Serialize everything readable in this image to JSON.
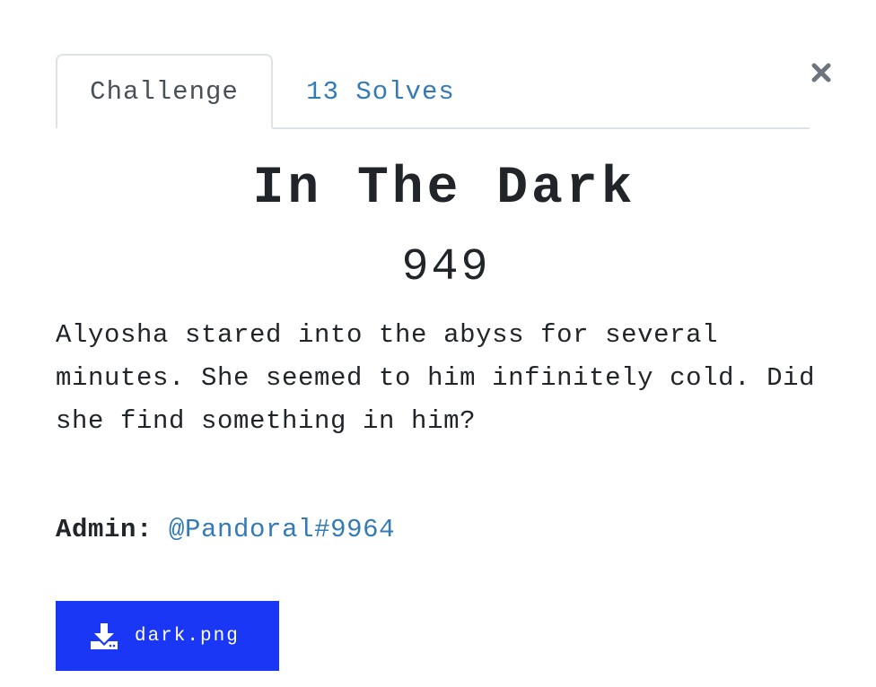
{
  "tabs": {
    "challenge_label": "Challenge",
    "solves_label": "13 Solves"
  },
  "challenge": {
    "title": "In The Dark",
    "value": "949",
    "description": "Alyosha stared into the abyss for several minutes. She seemed to him infinitely cold. Did she find something in him?",
    "admin_label": "Admin:",
    "admin_contact": "@Pandoral#9964"
  },
  "file": {
    "name": "dark.png",
    "icon": "download-icon"
  },
  "colors": {
    "link": "#337ab7",
    "download_button": "#1a37f5",
    "text": "#212529"
  }
}
